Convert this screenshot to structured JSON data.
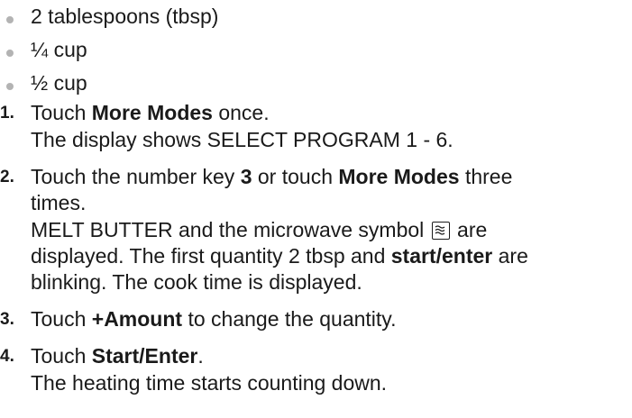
{
  "bullets": [
    "2 tablespoons (tbsp)",
    "¼ cup",
    "½ cup"
  ],
  "steps": [
    {
      "number": "1.",
      "pre": "Touch ",
      "bold": "More Modes",
      "post": " once.",
      "sub": "The display shows SELECT PROGRAM 1 - 6."
    },
    {
      "number": "2.",
      "l1_pre": "Touch the number key ",
      "l1_b1": "3",
      "l1_mid": " or touch ",
      "l1_b2": "More Modes",
      "l1_post": " three",
      "l2": "times.",
      "s1_pre": "MELT BUTTER and the microwave symbol ",
      "s1_post": " are",
      "s2_pre": "displayed. The first quantity 2 tbsp and ",
      "s2_bold": "start/enter",
      "s2_post": " are",
      "s3": "blinking. The cook time is displayed.",
      "icon": "microwave-symbol-icon"
    },
    {
      "number": "3.",
      "pre": "Touch ",
      "bold": "+Amount",
      "post": " to change the quantity."
    },
    {
      "number": "4.",
      "pre": "Touch ",
      "bold": "Start/Enter",
      "post": ".",
      "sub": "The heating time starts counting down."
    }
  ]
}
